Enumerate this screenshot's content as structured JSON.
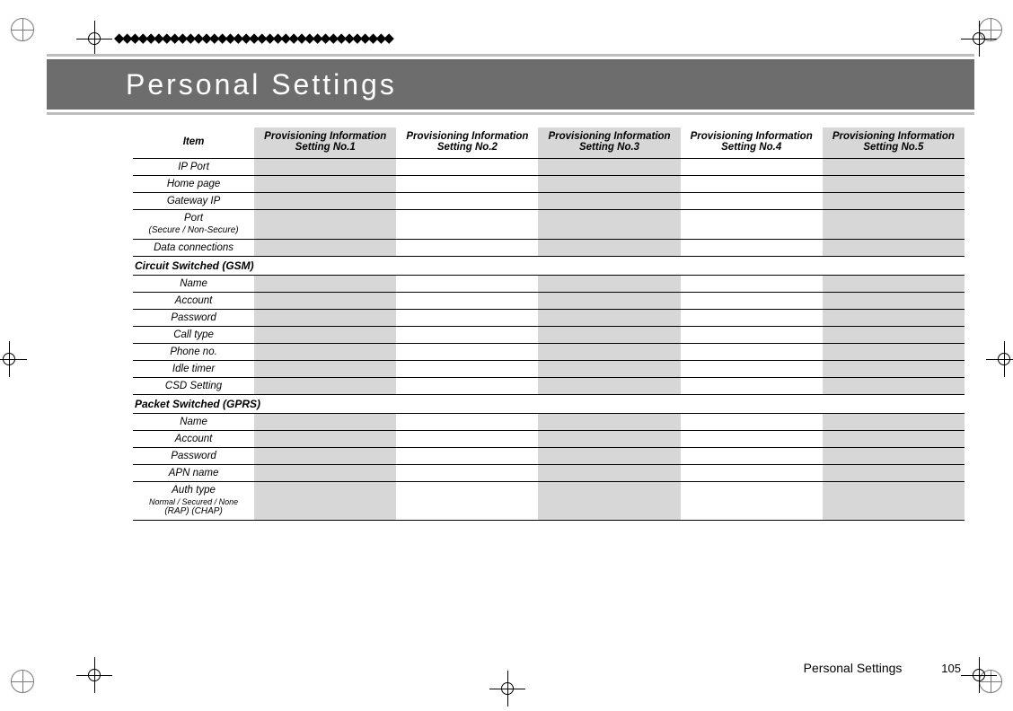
{
  "banner": {
    "title": "Personal Settings"
  },
  "columns": {
    "item": "Item",
    "c1": "Provisioning Information Setting No.1",
    "c2": "Provisioning Information Setting No.2",
    "c3": "Provisioning Information Setting No.3",
    "c4": "Provisioning Information Setting No.4",
    "c5": "Provisioning Information Setting No.5"
  },
  "rows_top": {
    "ip_port": "IP Port",
    "home_page": "Home page",
    "gateway_ip": "Gateway IP",
    "port": "Port",
    "port_sub": "(Secure / Non-Secure)",
    "data_conn": "Data connections"
  },
  "section_gsm": "Circuit Switched (GSM)",
  "rows_gsm": {
    "name": "Name",
    "account": "Account",
    "password": "Password",
    "call_type": "Call type",
    "phone_no": "Phone no.",
    "idle_timer": "Idle timer",
    "csd_setting": "CSD Setting"
  },
  "section_gprs": "Packet Switched (GPRS)",
  "rows_gprs": {
    "name": "Name",
    "account": "Account",
    "password": "Password",
    "apn_name": "APN name",
    "auth_type": "Auth type",
    "auth_sub1": "Normal / Secured / None",
    "auth_sub2": "(RAP)  (CHAP)"
  },
  "footer": {
    "label": "Personal Settings",
    "page": "105"
  }
}
